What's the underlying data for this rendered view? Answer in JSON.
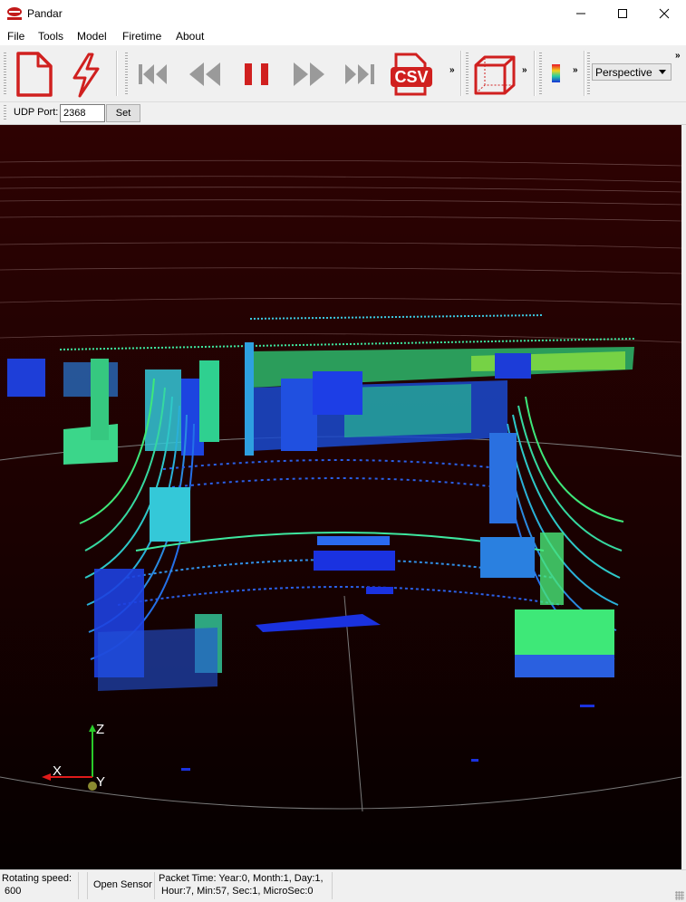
{
  "window": {
    "title": "Pandar",
    "app_icon_text": "HESAI"
  },
  "menu": [
    "File",
    "Tools",
    "Model",
    "Firetime",
    "About"
  ],
  "toolbar": {
    "buttons": [
      {
        "name": "new-file",
        "icon": "document-icon"
      },
      {
        "name": "open-sensor",
        "icon": "lightning-icon"
      },
      {
        "name": "go-to-start",
        "icon": "skip-back-icon"
      },
      {
        "name": "rewind",
        "icon": "rewind-icon"
      },
      {
        "name": "pause",
        "icon": "pause-icon"
      },
      {
        "name": "fast-forward",
        "icon": "fast-forward-icon"
      },
      {
        "name": "go-to-end",
        "icon": "skip-forward-icon"
      },
      {
        "name": "export-csv",
        "icon": "csv-icon"
      },
      {
        "name": "bounding-box",
        "icon": "cube-icon"
      },
      {
        "name": "color-map",
        "icon": "color-legend-icon"
      }
    ],
    "csv_label": "CSV",
    "extension_glyph": "»",
    "view_mode": "Perspective"
  },
  "udp": {
    "label": "UDP Port:",
    "value": "2368",
    "set_label": "Set"
  },
  "axes": {
    "x": "X",
    "y": "Y",
    "z": "Z"
  },
  "status": {
    "rotating_label": "Rotating speed:",
    "rotating_value": "600",
    "sensor": "Open Sensor",
    "packet_line1": "Packet Time: Year:0, Month:1, Day:1,",
    "packet_line2": "Hour:7, Min:57, Sec:1, MicroSec:0"
  },
  "colors": {
    "accent_red": "#d0201f",
    "media_gray": "#9a9a9a",
    "viewport_bg": "#2a0202",
    "scan_blue": "#1a3cff",
    "scan_cyan": "#22d8e8",
    "scan_green": "#3cf05a"
  }
}
